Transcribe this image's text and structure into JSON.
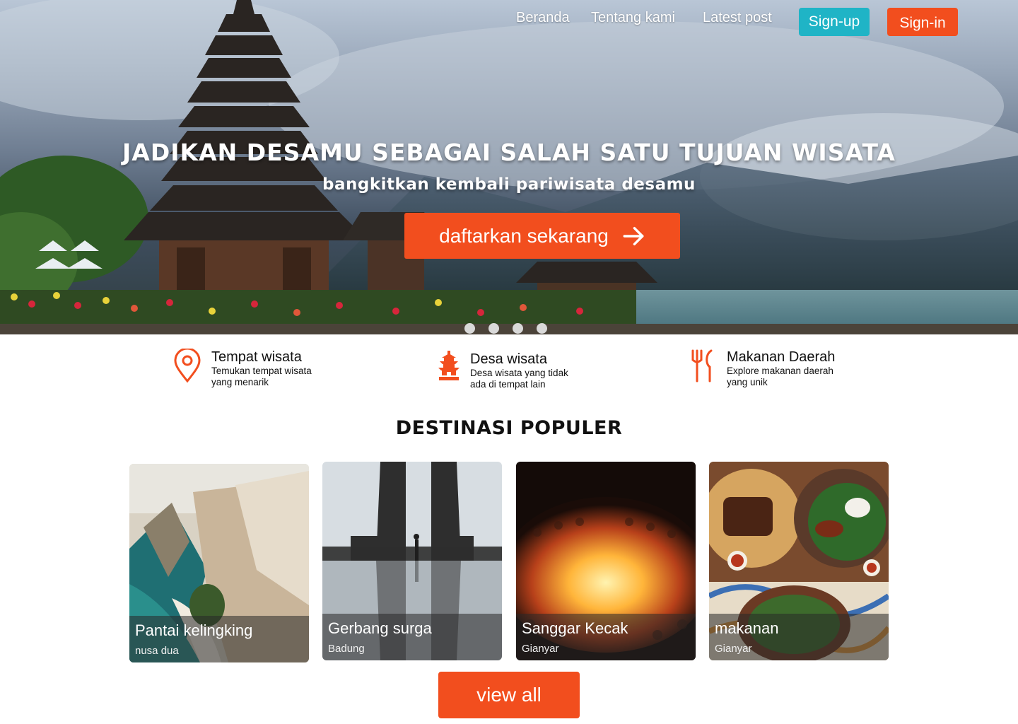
{
  "nav": {
    "links": [
      "Beranda",
      "Tentang kami",
      "Latest post"
    ],
    "signup_label": "Sign-up",
    "signin_label": "Sign-in"
  },
  "hero": {
    "title": "JADIKAN DESAMU SEBAGAI SALAH SATU TUJUAN WISATA",
    "subtitle": "bangkitkan kembali pariwisata desamu",
    "cta_label": "daftarkan sekarang",
    "slide_count": 4
  },
  "features": [
    {
      "icon": "location-pin-icon",
      "title": "Tempat wisata",
      "desc": "Temukan tempat wisata yang menarik"
    },
    {
      "icon": "pagoda-icon",
      "title": "Desa wisata",
      "desc": "Desa wisata yang tidak ada di tempat lain"
    },
    {
      "icon": "fork-knife-icon",
      "title": "Makanan Daerah",
      "desc": "Explore makanan daerah yang unik"
    }
  ],
  "popular": {
    "title": "DESTINASI POPULER",
    "cards": [
      {
        "title": "Pantai kelingking",
        "subtitle": "nusa dua"
      },
      {
        "title": "Gerbang surga",
        "subtitle": "Badung"
      },
      {
        "title": "Sanggar Kecak",
        "subtitle": "Gianyar"
      },
      {
        "title": "makanan",
        "subtitle": "Gianyar"
      }
    ],
    "view_all_label": "view all"
  },
  "colors": {
    "accent": "#f24e1e",
    "signup": "#1fb4c6"
  }
}
